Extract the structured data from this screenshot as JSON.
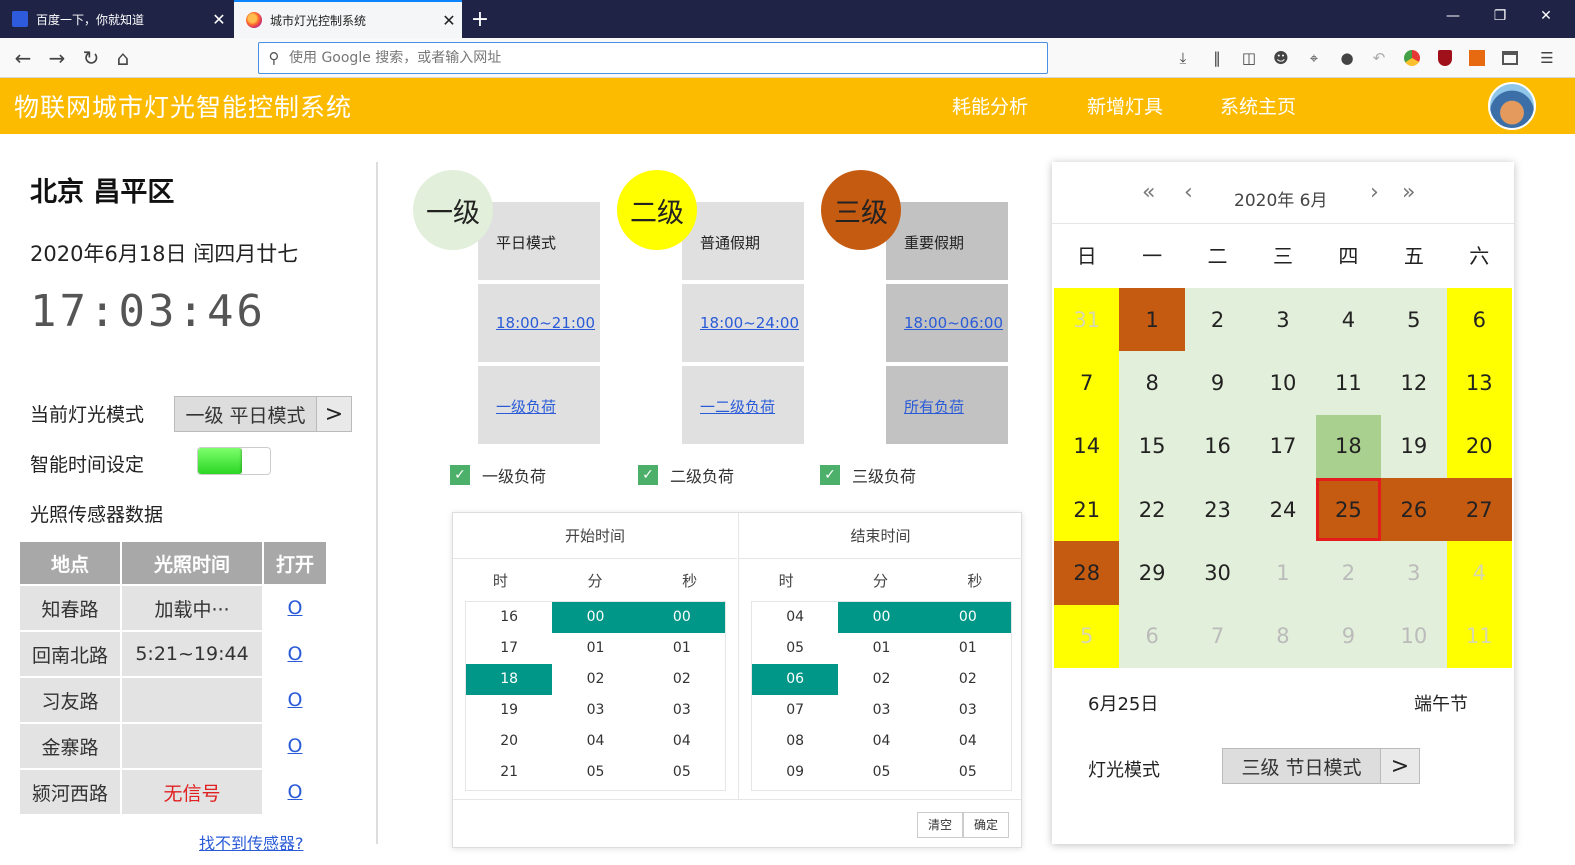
{
  "browser": {
    "tabs": [
      {
        "title": "百度一下，你就知道",
        "close": "✕"
      },
      {
        "title": "城市灯光控制系统",
        "close": "✕"
      }
    ],
    "new_tab": "+",
    "window": {
      "minimize": "—",
      "restore": "❐",
      "close": "✕"
    },
    "nav": {
      "back": "←",
      "forward": "→",
      "reload": "↻",
      "home": "⌂"
    },
    "address_placeholder": "使用 Google 搜索，或者输入网址",
    "toolbar_icons": [
      "download-icon",
      "library-icon",
      "sidebar-icon",
      "account-icon",
      "screenshot-icon",
      "chat-icon",
      "undo-icon",
      "chrome-icon",
      "ublock-icon",
      "extension-icon",
      "container-icon",
      "menu-icon"
    ]
  },
  "app": {
    "title": "物联网城市灯光智能控制系统",
    "nav": [
      "耗能分析",
      "新增灯具",
      "系统主页"
    ]
  },
  "left": {
    "city": "北京 昌平区",
    "date": "2020年6月18日  闰四月廿七",
    "clock": "17:03:46",
    "mode_label": "当前灯光模式",
    "mode_value": "一级  平日模式",
    "mode_arrow": ">",
    "smart_label": "智能时间设定",
    "smart_on": true,
    "sensor_label": "光照传感器数据",
    "table": {
      "headers": [
        "地点",
        "光照时间",
        "打开"
      ],
      "rows": [
        {
          "place": "知春路",
          "time": "加载中···",
          "open": "O"
        },
        {
          "place": "回南北路",
          "time": "5:21~19:44",
          "open": "O"
        },
        {
          "place": "习友路",
          "time": "",
          "open": "O"
        },
        {
          "place": "金寨路",
          "time": "",
          "open": "O"
        },
        {
          "place": "颍河西路",
          "time": "无信号",
          "open": "O"
        }
      ]
    },
    "cant_find": "找不到传感器?"
  },
  "levels": [
    {
      "badge": "一级",
      "mode": "平日模式",
      "time": "18:00~21:00",
      "load": "一级负荷",
      "color": "#e2efda",
      "check_label": "一级负荷"
    },
    {
      "badge": "二级",
      "mode": "普通假期",
      "time": "18:00~24:00",
      "load": "一二级负荷",
      "color": "#ffff00",
      "check_label": "二级负荷"
    },
    {
      "badge": "三级",
      "mode": "重要假期",
      "time": "18:00~06:00",
      "load": "所有负荷",
      "color": "#c55a11",
      "check_label": "三级负荷"
    }
  ],
  "picker": {
    "start_title": "开始时间",
    "end_title": "结束时间",
    "col_heads": [
      "时",
      "分",
      "秒"
    ],
    "start": {
      "hours": [
        "16",
        "17",
        "18",
        "19",
        "20",
        "21"
      ],
      "minutes": [
        "00",
        "01",
        "02",
        "03",
        "04",
        "05"
      ],
      "seconds": [
        "00",
        "01",
        "02",
        "03",
        "04",
        "05"
      ],
      "selected": {
        "hour": "18",
        "minute": "00",
        "second": "00"
      }
    },
    "end": {
      "hours": [
        "04",
        "05",
        "06",
        "07",
        "08",
        "09"
      ],
      "minutes": [
        "00",
        "01",
        "02",
        "03",
        "04",
        "05"
      ],
      "seconds": [
        "00",
        "01",
        "02",
        "03",
        "04",
        "05"
      ],
      "selected": {
        "hour": "06",
        "minute": "00",
        "second": "00"
      }
    },
    "clear": "清空",
    "confirm": "确定"
  },
  "calendar": {
    "prev_year": "«",
    "prev_month": "‹",
    "next_month": "›",
    "next_year": "»",
    "year_month": "2020年  6月",
    "weekdays": [
      "日",
      "一",
      "二",
      "三",
      "四",
      "五",
      "六"
    ],
    "days": [
      {
        "d": "31",
        "t": "we oth"
      },
      {
        "d": "1",
        "t": "hol"
      },
      {
        "d": "2",
        "t": ""
      },
      {
        "d": "3",
        "t": ""
      },
      {
        "d": "4",
        "t": ""
      },
      {
        "d": "5",
        "t": ""
      },
      {
        "d": "6",
        "t": "we"
      },
      {
        "d": "7",
        "t": "we"
      },
      {
        "d": "8",
        "t": ""
      },
      {
        "d": "9",
        "t": ""
      },
      {
        "d": "10",
        "t": ""
      },
      {
        "d": "11",
        "t": ""
      },
      {
        "d": "12",
        "t": ""
      },
      {
        "d": "13",
        "t": "we"
      },
      {
        "d": "14",
        "t": "we"
      },
      {
        "d": "15",
        "t": ""
      },
      {
        "d": "16",
        "t": ""
      },
      {
        "d": "17",
        "t": ""
      },
      {
        "d": "18",
        "t": "today"
      },
      {
        "d": "19",
        "t": ""
      },
      {
        "d": "20",
        "t": "we"
      },
      {
        "d": "21",
        "t": "we"
      },
      {
        "d": "22",
        "t": ""
      },
      {
        "d": "23",
        "t": ""
      },
      {
        "d": "24",
        "t": ""
      },
      {
        "d": "25",
        "t": "hol selected"
      },
      {
        "d": "26",
        "t": "hol"
      },
      {
        "d": "27",
        "t": "hol"
      },
      {
        "d": "28",
        "t": "hol"
      },
      {
        "d": "29",
        "t": ""
      },
      {
        "d": "30",
        "t": ""
      },
      {
        "d": "1",
        "t": "oth"
      },
      {
        "d": "2",
        "t": "oth"
      },
      {
        "d": "3",
        "t": "oth"
      },
      {
        "d": "4",
        "t": "we oth"
      },
      {
        "d": "5",
        "t": "we oth"
      },
      {
        "d": "6",
        "t": "oth"
      },
      {
        "d": "7",
        "t": "oth"
      },
      {
        "d": "8",
        "t": "oth"
      },
      {
        "d": "9",
        "t": "oth"
      },
      {
        "d": "10",
        "t": "oth"
      },
      {
        "d": "11",
        "t": "we oth"
      }
    ],
    "selected_date": "6月25日",
    "festival": "端午节",
    "mode_label": "灯光模式",
    "mode_value": "三级  节日模式",
    "mode_arrow": ">"
  },
  "colors": {
    "header": "#fdbb00",
    "accent": "#009688",
    "holiday": "#c55a11",
    "weekend": "#ffff00",
    "workday": "#e2efda",
    "today": "#a9d08e",
    "selected_border": "#e51c1c"
  }
}
